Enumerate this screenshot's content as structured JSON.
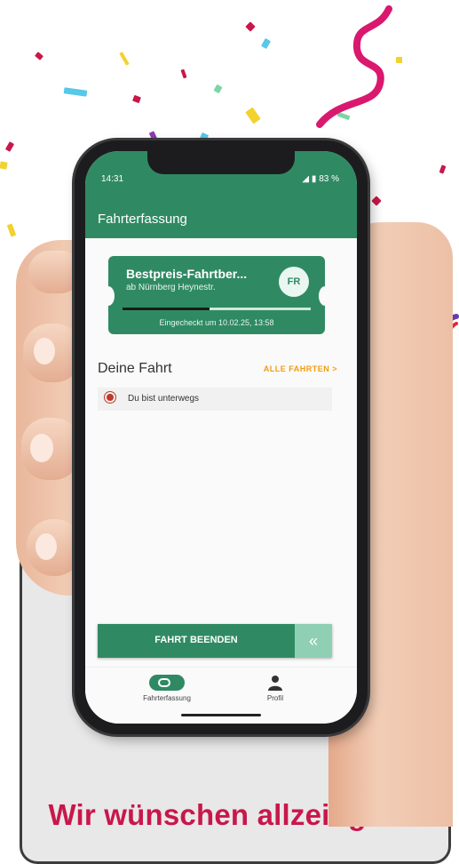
{
  "status_bar": {
    "time": "14:31",
    "battery": "83 %"
  },
  "app_bar": {
    "title": "Fahrterfassung"
  },
  "ticket": {
    "title": "Bestpreis-Fahrtber...",
    "subtitle": "ab Nürnberg Heynestr.",
    "badge": "FR",
    "checked_in": "Eingecheckt um 10.02.25, 13:58",
    "progress": 0.46
  },
  "section": {
    "title": "Deine Fahrt",
    "link": "ALLE FAHRTEN >"
  },
  "trip": {
    "status": "Du bist unterwegs"
  },
  "end_button": {
    "label": "FAHRT BEENDEN",
    "arrow": "«"
  },
  "bottom_nav": {
    "items": [
      {
        "label": "Fahrterfassung"
      },
      {
        "label": "Profil"
      }
    ]
  },
  "slogan": "Wir wünschen allzeit gute",
  "colors": {
    "brand_green": "#2f8a63",
    "accent_orange": "#f39c12",
    "slogan_red": "#c8174b"
  }
}
